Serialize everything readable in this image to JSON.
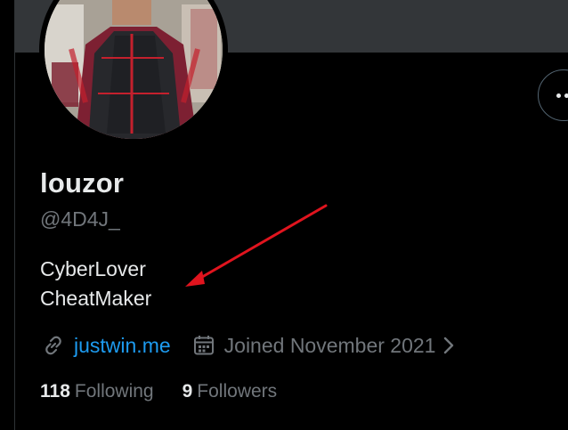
{
  "profile": {
    "display_name": "louzor",
    "handle": "@4D4J_",
    "bio_lines": [
      "CyberLover",
      "CheatMaker"
    ],
    "website": "justwin.me",
    "joined": "Joined November 2021",
    "following_count": "118",
    "following_label": "Following",
    "followers_count": "9",
    "followers_label": "Followers"
  },
  "icons": {
    "more": "more-horizontal-icon",
    "link": "link-icon",
    "calendar": "calendar-icon",
    "chevron": "chevron-right-icon"
  },
  "colors": {
    "background": "#000000",
    "banner": "#333639",
    "primary_text": "#e7e9ea",
    "secondary_text": "#71767b",
    "link": "#1d9bf0",
    "annotation": "#e0141e"
  }
}
